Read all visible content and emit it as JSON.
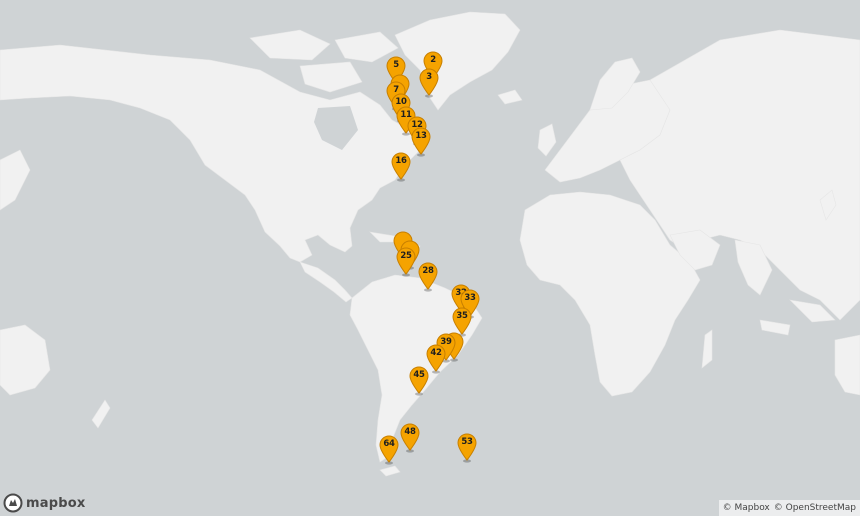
{
  "map": {
    "logo_text": "mapbox",
    "attribution": [
      "© Mapbox",
      "© OpenStreetMap"
    ],
    "colors": {
      "water": "#cfd3d5",
      "land": "#f1f1f1",
      "marker": "#f5a300",
      "marker_stroke": "#c77f00"
    }
  },
  "markers": [
    {
      "label": "2"
    },
    {
      "label": "3"
    },
    {
      "label": "5"
    },
    {
      "label": "7"
    },
    {
      "label": "10"
    },
    {
      "label": "11"
    },
    {
      "label": "12"
    },
    {
      "label": "13"
    },
    {
      "label": "16"
    },
    {
      "label": "20"
    },
    {
      "label": "25"
    },
    {
      "label": "28"
    },
    {
      "label": "32"
    },
    {
      "label": "33"
    },
    {
      "label": "35"
    },
    {
      "label": "39"
    },
    {
      "label": "42"
    },
    {
      "label": "45"
    },
    {
      "label": "48"
    },
    {
      "label": "53"
    },
    {
      "label": "64"
    }
  ]
}
